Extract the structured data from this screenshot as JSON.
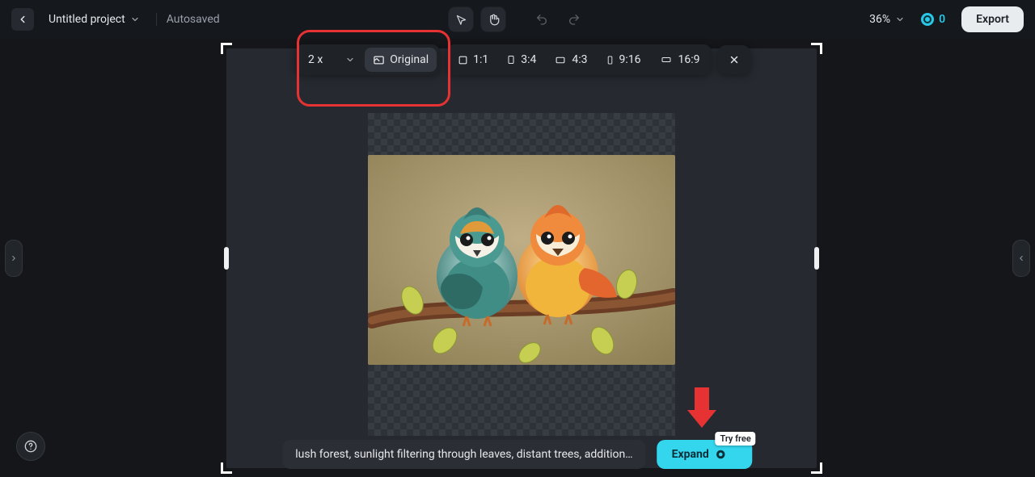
{
  "header": {
    "project_name": "Untitled project",
    "status": "Autosaved",
    "zoom": "36%",
    "credits": "0",
    "export_label": "Export"
  },
  "crop_bar": {
    "scale": "2 x",
    "options": [
      {
        "key": "original",
        "label": "Original",
        "selected": true
      },
      {
        "key": "1_1",
        "label": "1:1"
      },
      {
        "key": "3_4",
        "label": "3:4"
      },
      {
        "key": "4_3",
        "label": "4:3"
      },
      {
        "key": "9_16",
        "label": "9:16"
      },
      {
        "key": "16_9",
        "label": "16:9"
      }
    ]
  },
  "prompt_text": "lush forest, sunlight filtering through leaves, distant trees, addition…",
  "expand": {
    "label": "Expand",
    "badge": "Try free"
  },
  "canvas": {
    "subject": "Two stylized cartoon birds (teal-green and orange-yellow) perched on a branch with leaves, warm beige background"
  }
}
